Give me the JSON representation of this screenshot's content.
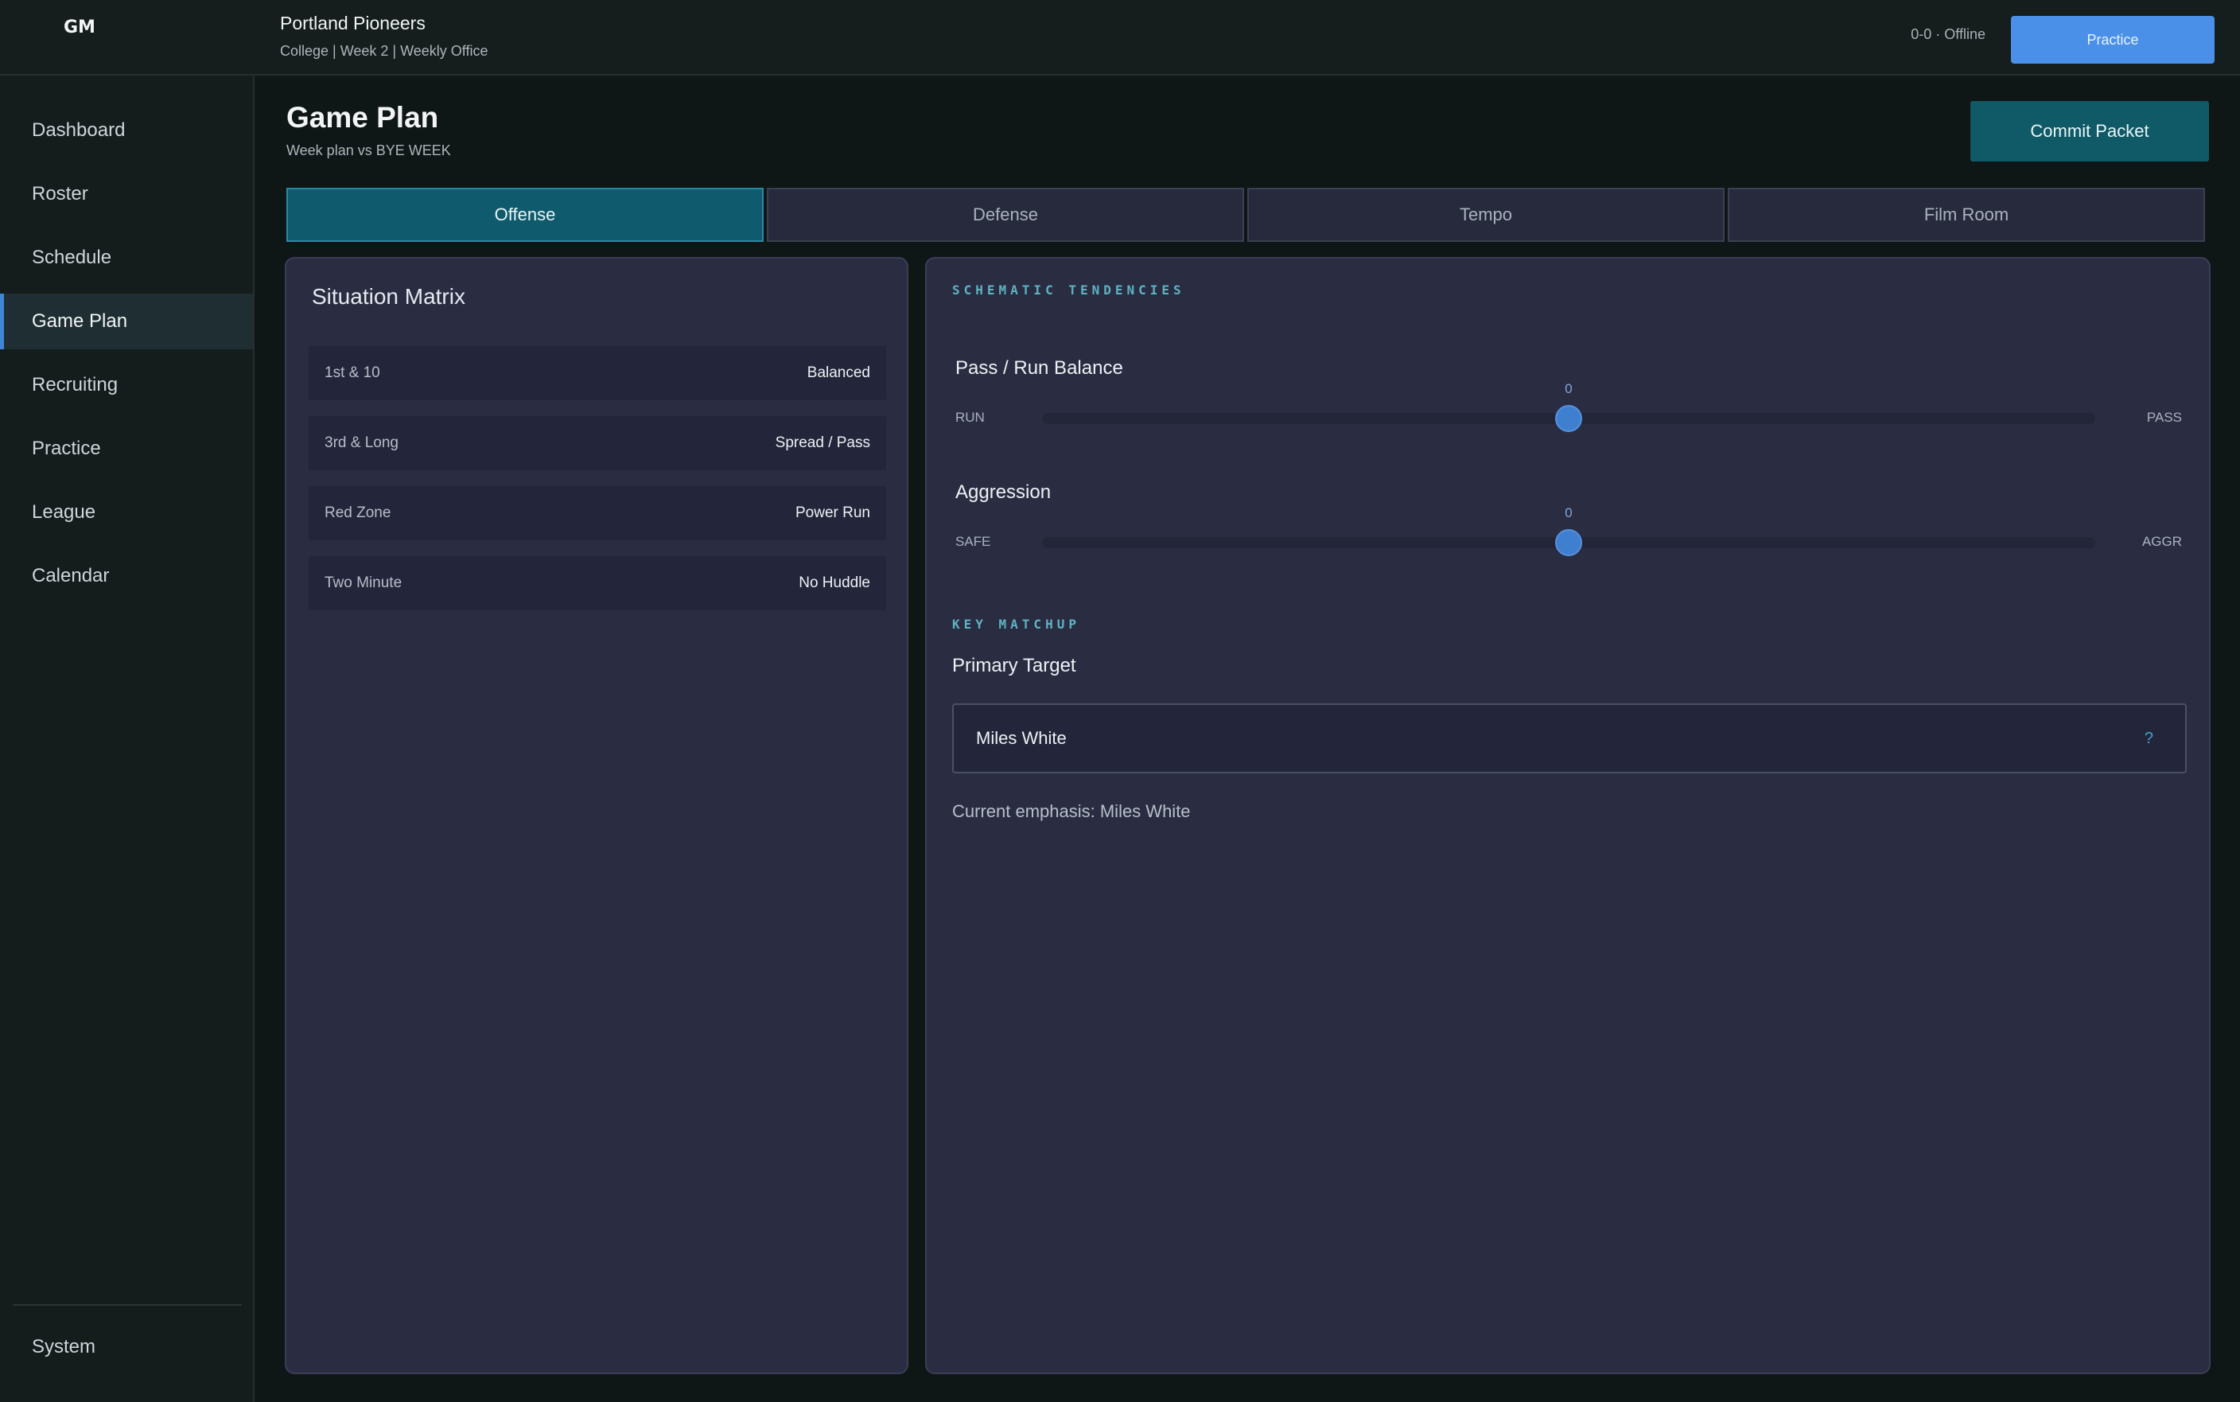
{
  "header": {
    "logo_text": "GM",
    "team_name": "Portland Pioneers",
    "team_sub": "College | Week 2 | Weekly Office",
    "status": "0-0 · Offline",
    "practice_label": "Practice"
  },
  "sidebar": {
    "items": [
      {
        "label": "Dashboard"
      },
      {
        "label": "Roster"
      },
      {
        "label": "Schedule"
      },
      {
        "label": "Game Plan",
        "active": true
      },
      {
        "label": "Recruiting"
      },
      {
        "label": "Practice"
      },
      {
        "label": "League"
      },
      {
        "label": "Calendar"
      }
    ],
    "bottom_item": "System"
  },
  "page": {
    "title": "Game Plan",
    "subtitle": "Week plan vs BYE WEEK",
    "commit_label": "Commit Packet"
  },
  "tabs": [
    {
      "label": "Offense",
      "active": true
    },
    {
      "label": "Defense"
    },
    {
      "label": "Tempo"
    },
    {
      "label": "Film Room"
    }
  ],
  "situation_matrix": {
    "title": "Situation Matrix",
    "rows": [
      {
        "situation": "1st & 10",
        "call": "Balanced"
      },
      {
        "situation": "3rd & Long",
        "call": "Spread / Pass"
      },
      {
        "situation": "Red Zone",
        "call": "Power Run"
      },
      {
        "situation": "Two Minute",
        "call": "No Huddle"
      }
    ]
  },
  "tendencies": {
    "section_label": "SCHEMATIC TENDENCIES",
    "sliders": [
      {
        "title": "Pass / Run Balance",
        "left": "RUN",
        "right": "PASS",
        "value": "0",
        "position": 0.5
      },
      {
        "title": "Aggression",
        "left": "SAFE",
        "right": "AGGR",
        "value": "0",
        "position": 0.5
      }
    ]
  },
  "matchup": {
    "section_label": "KEY MATCHUP",
    "primary_target_label": "Primary Target",
    "selected": "Miles White",
    "select_hint": "?",
    "emphasis": "Current emphasis: Miles White"
  },
  "colors": {
    "accent": "#4a90e8",
    "tab_active": "#0f5a6c",
    "commit": "#0f5a66",
    "panel": "#2a2d42"
  }
}
